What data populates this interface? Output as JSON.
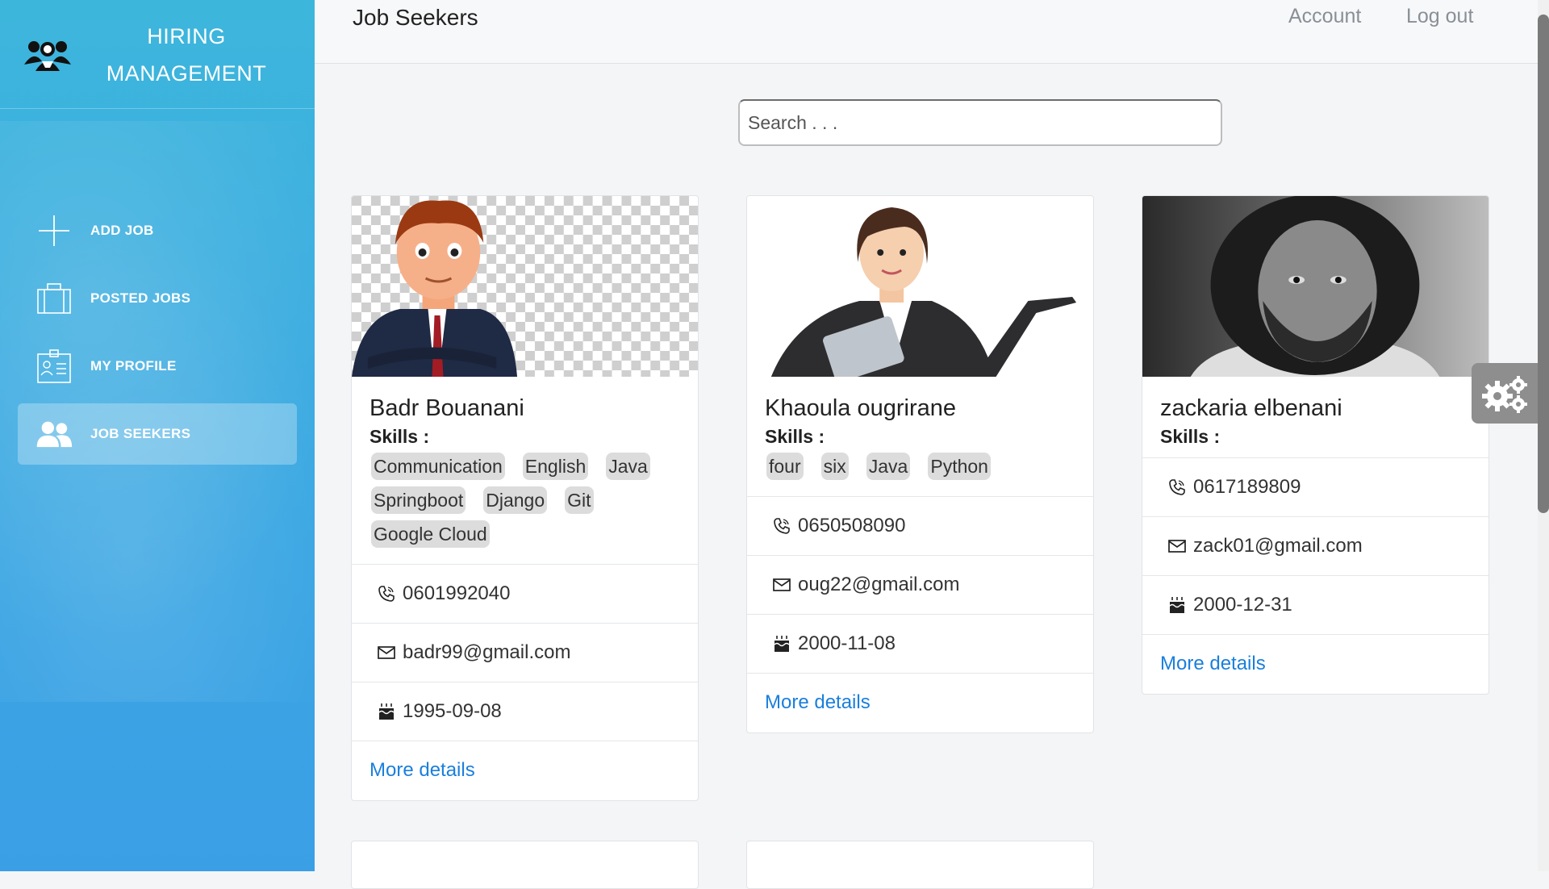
{
  "app": {
    "brand_line1": "HIRING",
    "brand_line2": "MANAGEMENT",
    "logo_icon": "people-group-icon"
  },
  "sidebar": {
    "items": [
      {
        "label": "ADD JOB",
        "icon": "plus-icon",
        "active": false
      },
      {
        "label": "POSTED JOBS",
        "icon": "briefcase-icon",
        "active": false
      },
      {
        "label": "MY PROFILE",
        "icon": "id-badge-icon",
        "active": false
      },
      {
        "label": "JOB SEEKERS",
        "icon": "users-icon",
        "active": true
      }
    ]
  },
  "header": {
    "title": "Job Seekers",
    "account": "Account",
    "logout": "Log out"
  },
  "search": {
    "placeholder": "Search . . ."
  },
  "colors": {
    "sidebar_top": "#3db6dc",
    "sidebar_bottom": "#3b9fe6",
    "link": "#1a7fdc",
    "skill_badge": "#dcdcdc"
  },
  "skills_label": "Skills :",
  "more_label": "More details",
  "seekers": [
    {
      "name": "Badr Bouanani",
      "skills": [
        "Communication",
        "English",
        "Java",
        "Springboot",
        "Django",
        "Git",
        "Google Cloud"
      ],
      "phone": "0601992040",
      "email": "badr99@gmail.com",
      "birthdate": "1995-09-08"
    },
    {
      "name": "Khaoula ougrirane",
      "skills": [
        "four",
        "six",
        "Java",
        "Python"
      ],
      "phone": "0650508090",
      "email": "oug22@gmail.com",
      "birthdate": "2000-11-08"
    },
    {
      "name": "zackaria elbenani",
      "skills": [],
      "phone": "0617189809",
      "email": "zack01@gmail.com",
      "birthdate": "2000-12-31"
    }
  ]
}
